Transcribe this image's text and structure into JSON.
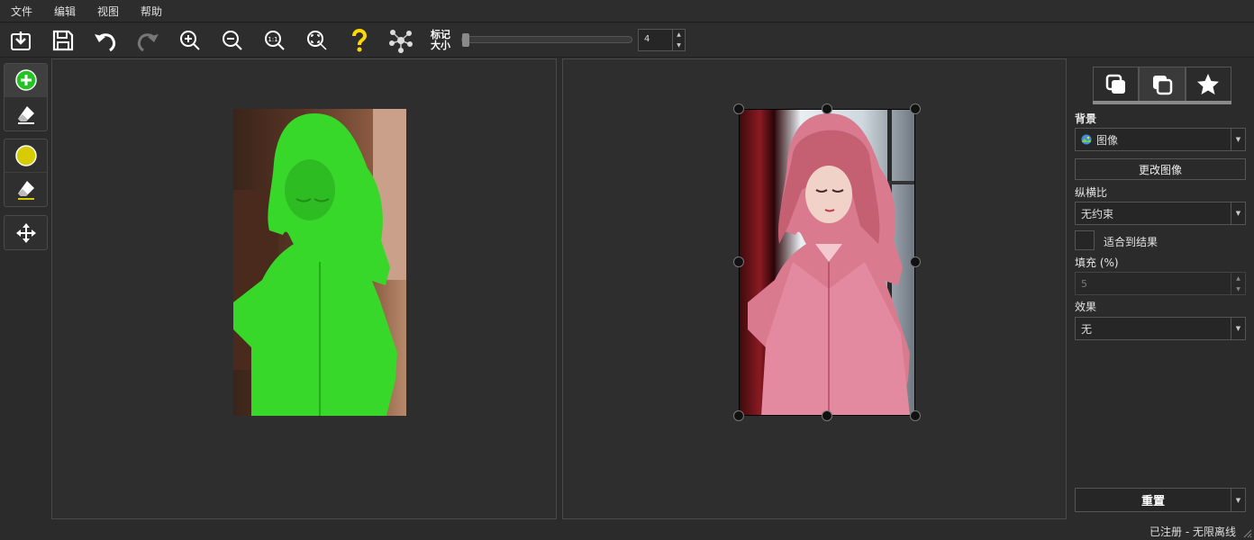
{
  "menu": {
    "items": [
      "文件",
      "编辑",
      "视图",
      "帮助"
    ]
  },
  "toolbar": {
    "mark_size_label": "标记大小",
    "mark_size_value": "4",
    "mark_size_slider_fraction": 0.0,
    "icons": [
      "import-icon",
      "save-icon",
      "undo-icon",
      "redo-icon",
      "zoom-in-icon",
      "zoom-out-icon",
      "zoom-actual-icon",
      "zoom-fit-icon",
      "help-icon",
      "network-icon"
    ]
  },
  "tools": [
    "add-foreground-icon",
    "eraser-icon",
    "background-marker-icon",
    "background-eraser-icon",
    "move-icon"
  ],
  "side": {
    "background_label": "背景",
    "background_value": "图像",
    "change_image_label": "更改图像",
    "aspect_label": "纵横比",
    "aspect_value": "无约束",
    "fit_label": "适合到结果",
    "fill_label": "填充 (%)",
    "fill_value": "5",
    "effect_label": "效果",
    "effect_value": "无",
    "reset_label": "重置"
  },
  "status": {
    "text": "已注册 - 无限离线"
  },
  "colors": {
    "foreground_mark": "#38d82a",
    "background_mark": "#d6cc00",
    "add_tool": "#22c322"
  }
}
